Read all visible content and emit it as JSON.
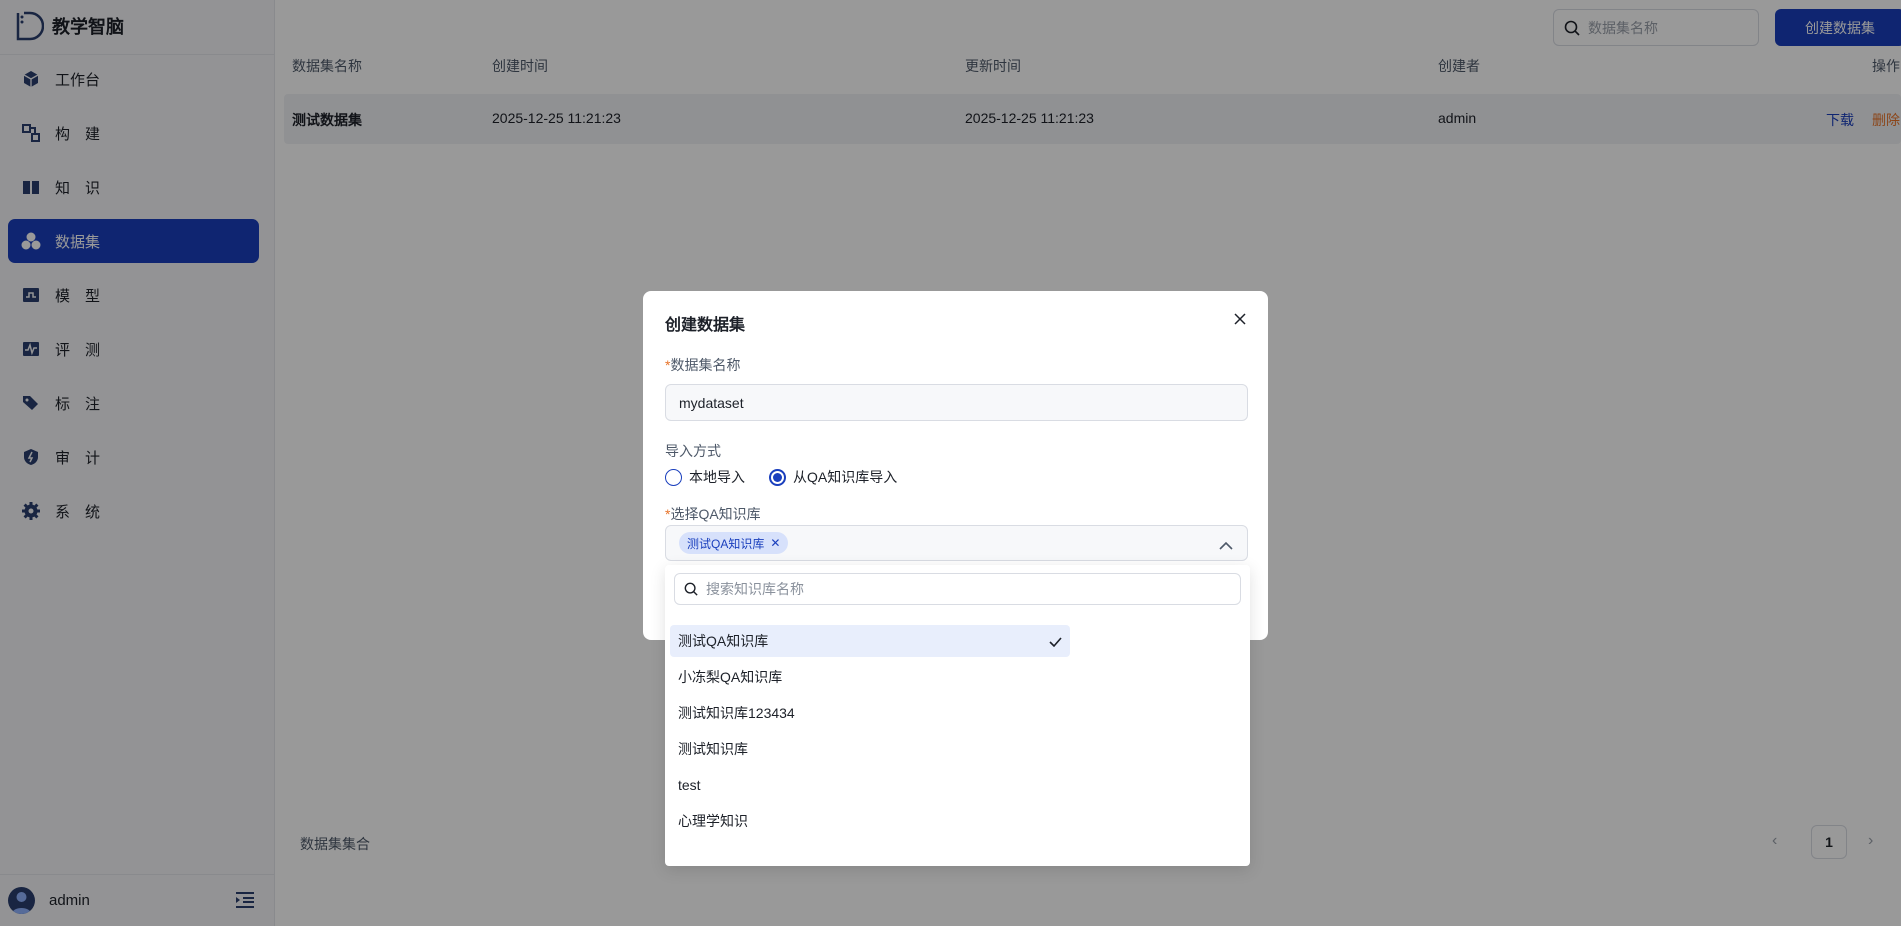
{
  "app": {
    "name": "教学智脑"
  },
  "sidebar": {
    "items": [
      {
        "label": "工作台",
        "icon": "cube-icon",
        "active": false
      },
      {
        "label": "构　建",
        "icon": "workflow-icon",
        "active": false
      },
      {
        "label": "知　识",
        "icon": "book-icon",
        "active": false
      },
      {
        "label": "数据集",
        "icon": "dataset-icon",
        "active": true
      },
      {
        "label": "模　型",
        "icon": "model-icon",
        "active": false
      },
      {
        "label": "评　测",
        "icon": "pulse-icon",
        "active": false
      },
      {
        "label": "标　注",
        "icon": "tag-icon",
        "active": false
      },
      {
        "label": "审　计",
        "icon": "shield-icon",
        "active": false
      },
      {
        "label": "系　统",
        "icon": "gear-icon",
        "active": false
      }
    ],
    "user": "admin"
  },
  "toolbar": {
    "search_placeholder": "数据集名称",
    "create_label": "创建数据集"
  },
  "table": {
    "columns": [
      "数据集名称",
      "创建时间",
      "更新时间",
      "创建者",
      "操作"
    ],
    "rows": [
      {
        "name": "测试数据集",
        "created": "2025-12-25 11:21:23",
        "updated": "2025-12-25 11:21:23",
        "creator": "admin",
        "actions": [
          "下载",
          "删除"
        ]
      }
    ]
  },
  "footer": {
    "label": "数据集集合",
    "page": "1"
  },
  "modal": {
    "title": "创建数据集",
    "name_label": "数据集名称",
    "name_value": "mydataset",
    "import_label": "导入方式",
    "import_options": [
      "本地导入",
      "从QA知识库导入"
    ],
    "import_selected": 1,
    "kb_label": "选择QA知识库",
    "selected_tags": [
      "测试QA知识库"
    ]
  },
  "dropdown": {
    "search_placeholder": "搜索知识库名称",
    "options": [
      "测试QA知识库",
      "小冻梨QA知识库",
      "测试知识库123434",
      "测试知识库",
      "test",
      "心理学知识"
    ],
    "selected_index": 0
  },
  "colors": {
    "primary": "#1a3fbd",
    "danger": "#e8742a",
    "overlay": "rgba(0,0,0,0.4)"
  }
}
